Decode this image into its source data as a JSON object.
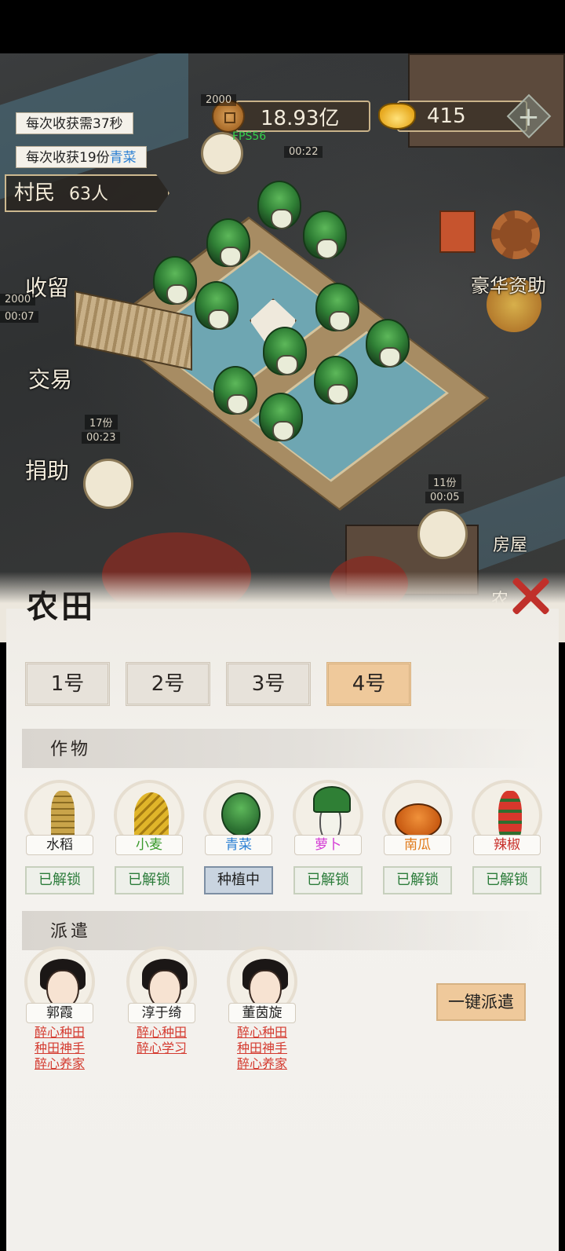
{
  "hud": {
    "coins": "18.93亿",
    "ingots": "415",
    "plus_label": "+",
    "fps": "FPS56",
    "harvest_time": "每次收获需37秒",
    "harvest_amount_prefix": "每次收获19份",
    "harvest_crop": "青菜",
    "villagers_label": "村民",
    "villagers_count": "63人",
    "timer_top": "00:22",
    "timer_top_label": "2000",
    "timer_left_a": "2000",
    "timer_left_b": "00:07",
    "share_17": "17份",
    "timer_17": "00:23",
    "share_11": "11份",
    "timer_11": "00:05"
  },
  "scene_labels": {
    "shelter": "收留",
    "trade": "交易",
    "donate": "捐助",
    "luxury": "豪华资助",
    "house": "房屋",
    "partial": "农"
  },
  "panel": {
    "title": "农田",
    "tabs": [
      {
        "label": "1号",
        "active": false
      },
      {
        "label": "2号",
        "active": false
      },
      {
        "label": "3号",
        "active": false
      },
      {
        "label": "4号",
        "active": true
      }
    ],
    "crops_section": "作物",
    "crops": [
      {
        "name": "水稻",
        "color": "#222222",
        "status": "已解锁",
        "icon": "rice-icon"
      },
      {
        "name": "小麦",
        "color": "#3a9a2c",
        "status": "已解锁",
        "icon": "wheat-icon"
      },
      {
        "name": "青菜",
        "color": "#2a7fd3",
        "status": "种植中",
        "icon": "cabbage-icon"
      },
      {
        "name": "萝卜",
        "color": "#d43bd4",
        "status": "已解锁",
        "icon": "radish-icon"
      },
      {
        "name": "南瓜",
        "color": "#e07a1a",
        "status": "已解锁",
        "icon": "pumpkin-icon"
      },
      {
        "name": "辣椒",
        "color": "#c8302a",
        "status": "已解锁",
        "icon": "chili-icon"
      }
    ],
    "dispatch_section": "派遣",
    "characters": [
      {
        "name": "郭霞",
        "traits": [
          "醉心种田",
          "种田神手",
          "醉心养家"
        ]
      },
      {
        "name": "淳于绮",
        "traits": [
          "醉心种田",
          "醉心学习"
        ]
      },
      {
        "name": "董茵旋",
        "traits": [
          "醉心种田",
          "种田神手",
          "醉心养家"
        ]
      }
    ],
    "dispatch_button": "一键派遣"
  }
}
